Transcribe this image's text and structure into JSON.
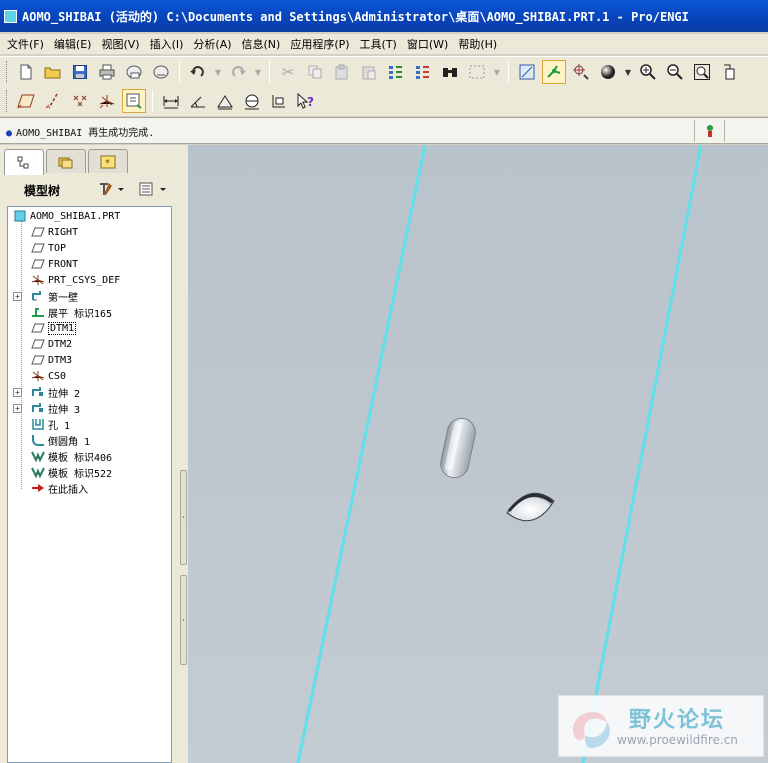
{
  "window": {
    "title": "AOMO_SHIBAI (活动的) C:\\Documents and Settings\\Administrator\\桌面\\AOMO_SHIBAI.PRT.1 - Pro/ENGI"
  },
  "menubar": {
    "items": [
      {
        "label": "文件(F)"
      },
      {
        "label": "编辑(E)"
      },
      {
        "label": "视图(V)"
      },
      {
        "label": "插入(I)"
      },
      {
        "label": "分析(A)"
      },
      {
        "label": "信息(N)"
      },
      {
        "label": "应用程序(P)"
      },
      {
        "label": "工具(T)"
      },
      {
        "label": "窗口(W)"
      },
      {
        "label": "帮助(H)"
      }
    ]
  },
  "toolbar": {
    "row1_icons": [
      "new-file-icon",
      "open-folder-icon",
      "save-icon",
      "print-icon",
      "send-email-icon",
      "email-link-icon",
      "undo-icon",
      "redo-icon",
      "cut-icon",
      "copy-icon",
      "paste-icon",
      "paste-special-icon",
      "regenerate-icon",
      "regen-manager-icon",
      "find-icon",
      "select-box-icon",
      "saved-view-icon",
      "datum-display-icon",
      "spin-center-icon",
      "shading-icon",
      "zoom-in-icon",
      "zoom-out-icon",
      "refit-icon",
      "reorient-icon"
    ],
    "row2_icons": [
      "datum-plane-icon",
      "datum-axis-icon",
      "datum-point-icon",
      "coord-system-icon",
      "annotation-icon",
      "measure-distance-icon",
      "measure-angle-icon",
      "measure-area-icon",
      "measure-diameter-icon",
      "measure-transform-icon",
      "whats-this-icon"
    ]
  },
  "status": {
    "message": "AOMO_SHIBAI 再生成功完成."
  },
  "model_tree": {
    "title": "模型树",
    "nodes": [
      {
        "label": "AOMO_SHIBAI.PRT",
        "icon": "part-icon",
        "level": 0,
        "expandable": false
      },
      {
        "label": "RIGHT",
        "icon": "datum-plane-icon",
        "level": 1,
        "expandable": false
      },
      {
        "label": "TOP",
        "icon": "datum-plane-icon",
        "level": 1,
        "expandable": false
      },
      {
        "label": "FRONT",
        "icon": "datum-plane-icon",
        "level": 1,
        "expandable": false
      },
      {
        "label": "PRT_CSYS_DEF",
        "icon": "coord-system-icon",
        "level": 1,
        "expandable": false
      },
      {
        "label": "第一壁",
        "icon": "sheetmetal-wall-icon",
        "level": 1,
        "expandable": true
      },
      {
        "label": "展平 标识165",
        "icon": "unbend-icon",
        "level": 1,
        "expandable": false
      },
      {
        "label": "DTM1",
        "icon": "datum-plane-icon",
        "level": 1,
        "expandable": false
      },
      {
        "label": "DTM2",
        "icon": "datum-plane-icon",
        "level": 1,
        "expandable": false
      },
      {
        "label": "DTM3",
        "icon": "datum-plane-icon",
        "level": 1,
        "expandable": false
      },
      {
        "label": "CS0",
        "icon": "coord-system-icon",
        "level": 1,
        "expandable": false
      },
      {
        "label": "拉伸 2",
        "icon": "extrude-icon",
        "level": 1,
        "expandable": true
      },
      {
        "label": "拉伸 3",
        "icon": "extrude-icon",
        "level": 1,
        "expandable": true
      },
      {
        "label": "孔 1",
        "icon": "hole-icon",
        "level": 1,
        "expandable": false
      },
      {
        "label": "倒圆角 1",
        "icon": "round-icon",
        "level": 1,
        "expandable": false
      },
      {
        "label": "模板 标识406",
        "icon": "form-icon",
        "level": 1,
        "expandable": false
      },
      {
        "label": "模板 标识522",
        "icon": "form-icon",
        "level": 1,
        "expandable": false
      },
      {
        "label": "在此插入",
        "icon": "insert-here-arrow-icon",
        "level": 1,
        "expandable": false
      }
    ]
  },
  "watermark": {
    "title": "野火论坛",
    "url": "www.proewildfire.cn"
  },
  "colors": {
    "title_bar": "#0a56d8",
    "viewport_bg": "#bcc5ce",
    "edge_highlight": "#5fe0ee",
    "tree_selected_border": "#000000"
  }
}
